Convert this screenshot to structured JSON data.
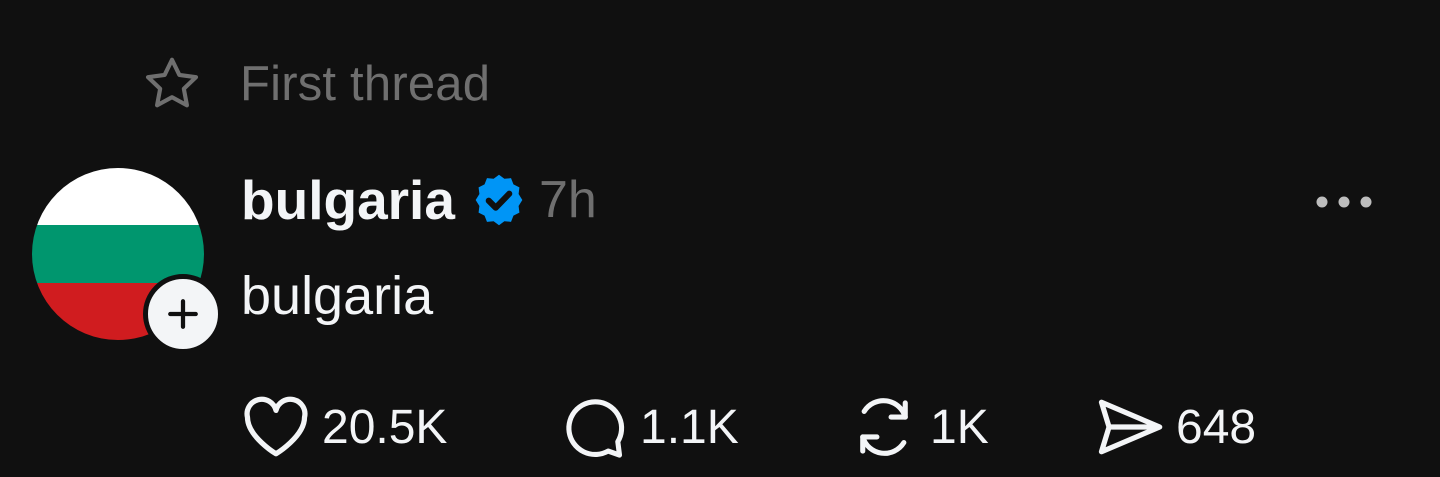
{
  "context": {
    "icon": "star-icon",
    "label": "First thread"
  },
  "post": {
    "avatar": {
      "description_icon": "bulgarian-flag-avatar",
      "flag_colors": [
        "#ffffff",
        "#00966e",
        "#d01c1f"
      ]
    },
    "author": "bulgaria",
    "verified_color": "#0095f6",
    "time": "7h",
    "text": "bulgaria"
  },
  "actions": {
    "likes": "20.5K",
    "replies": "1.1K",
    "reposts": "1K",
    "shares": "648"
  },
  "colors": {
    "background": "#101010",
    "primary_text": "#f3f5f7",
    "secondary_text": "#6f6f6f"
  }
}
